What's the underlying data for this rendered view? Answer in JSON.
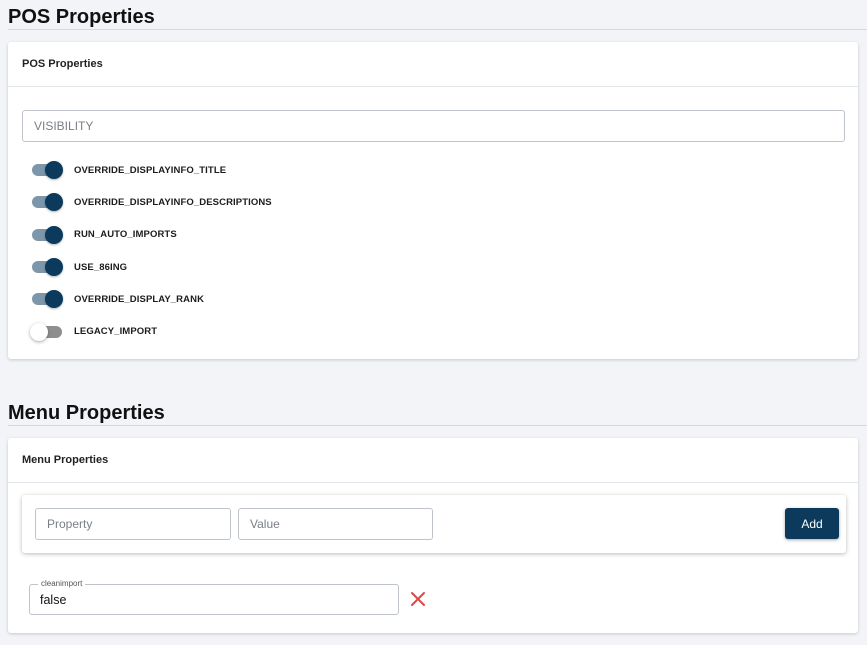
{
  "pos_section": {
    "title": "POS Properties",
    "card_title": "POS Properties",
    "search_placeholder": "VISIBILITY",
    "toggles": [
      {
        "label": "OVERRIDE_DISPLAYINFO_TITLE",
        "on": true
      },
      {
        "label": "OVERRIDE_DISPLAYINFO_DESCRIPTIONS",
        "on": true
      },
      {
        "label": "RUN_AUTO_IMPORTS",
        "on": true
      },
      {
        "label": "USE_86ING",
        "on": true
      },
      {
        "label": "OVERRIDE_DISPLAY_RANK",
        "on": true
      },
      {
        "label": "LEGACY_IMPORT",
        "on": false
      }
    ]
  },
  "menu_section": {
    "title": "Menu Properties",
    "card_title": "Menu Properties",
    "property_placeholder": "Property",
    "value_placeholder": "Value",
    "add_label": "Add",
    "properties": [
      {
        "key": "cleanimport",
        "value": "false"
      }
    ]
  },
  "colors": {
    "accent": "#0b3a5c",
    "toggle_track_on": "#7d96aa",
    "toggle_track_off": "#8f8f8f",
    "remove": "#e04848",
    "background": "#f2f4f7"
  },
  "icons": {
    "remove": "close-icon"
  }
}
